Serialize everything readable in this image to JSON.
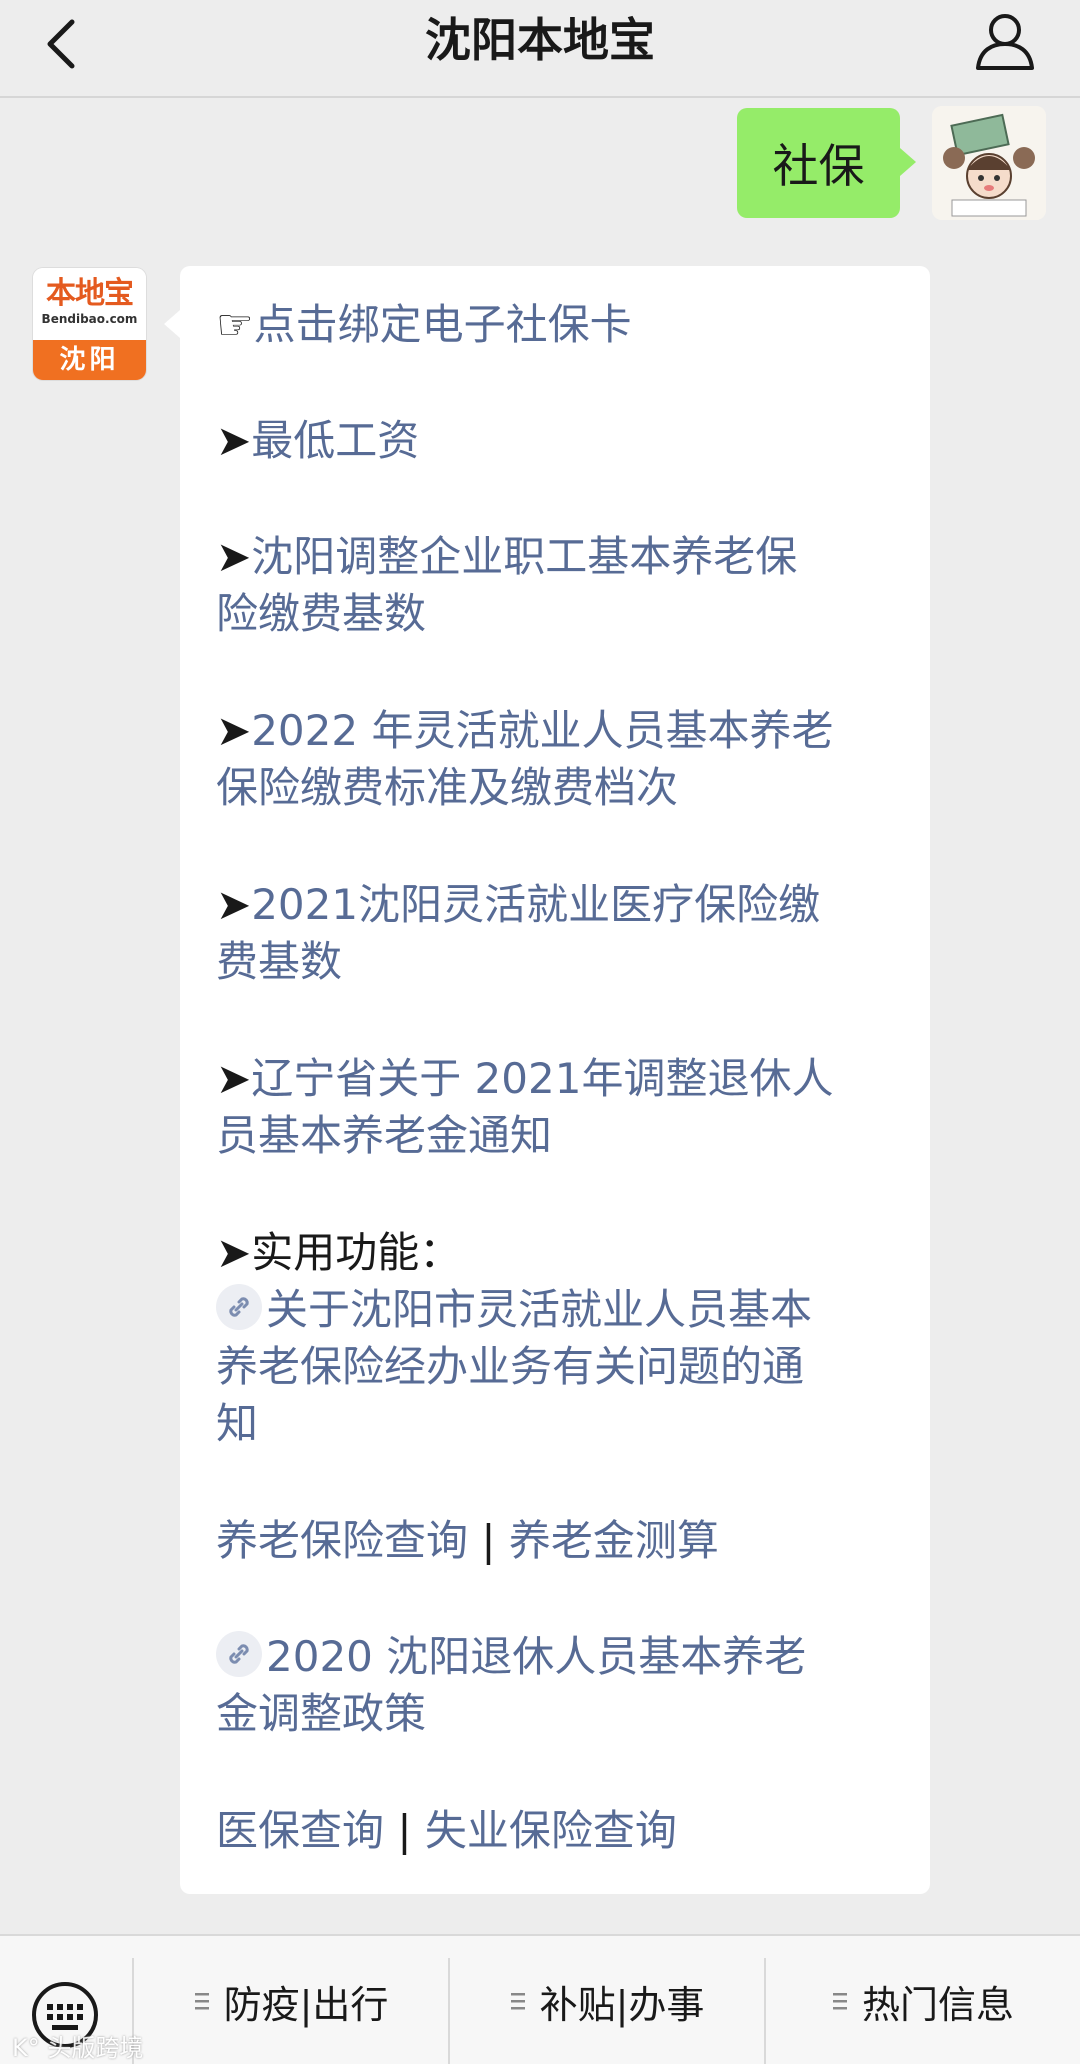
{
  "header": {
    "title": "沈阳本地宝",
    "back_icon": "chevron-left-icon",
    "profile_icon": "person-icon"
  },
  "user_message": {
    "text": "社保"
  },
  "bot": {
    "avatar": {
      "logo_text": "本地宝",
      "logo_domain": "Bendibao.com",
      "city": "沈阳"
    },
    "items": {
      "bind_card": {
        "mark": "☞",
        "text": "点击绑定电子社保卡"
      },
      "min_wage": {
        "mark": "➤",
        "text": "最低工资"
      },
      "adjust_base": {
        "mark": "➤",
        "line1": "沈阳调整企业职工基本养老保",
        "line2": "险缴费基数"
      },
      "flex_2022": {
        "mark": "➤",
        "line1": "2022 年灵活就业人员基本养老",
        "line2": "保险缴费标准及缴费档次"
      },
      "medical_2021": {
        "mark": "➤",
        "line1": "2021沈阳灵活就业医疗保险缴",
        "line2": "费基数"
      },
      "retire_2021": {
        "mark": "➤",
        "line1": "辽宁省关于 2021年调整退休人",
        "line2": "员基本养老金通知"
      },
      "practical": {
        "mark": "➤",
        "label": "实用功能：",
        "link_line1": "关于沈阳市灵活就业人员基本",
        "link_line2": "养老保险经办业务有关问题的通",
        "link_line3": "知"
      },
      "pension_query": "养老保险查询",
      "pension_calc": "养老金测算",
      "separator": "|",
      "policy_2020": {
        "line1": "2020 沈阳退休人员基本养老",
        "line2": "金调整政策"
      },
      "medical_query": "医保查询",
      "unemployment_query": "失业保险查询"
    }
  },
  "bottom_bar": {
    "keyboard_icon": "keyboard-icon",
    "menus": [
      {
        "label": "防疫|出行",
        "icon": "menu-lines-icon"
      },
      {
        "label": "补贴|办事",
        "icon": "menu-lines-icon"
      },
      {
        "label": "热门信息",
        "icon": "menu-lines-icon"
      }
    ]
  },
  "watermark": "K° 头版跨境",
  "colors": {
    "link": "#576b95",
    "user_bubble": "#95ec69",
    "background": "#ededed",
    "brand_orange": "#f07021"
  }
}
